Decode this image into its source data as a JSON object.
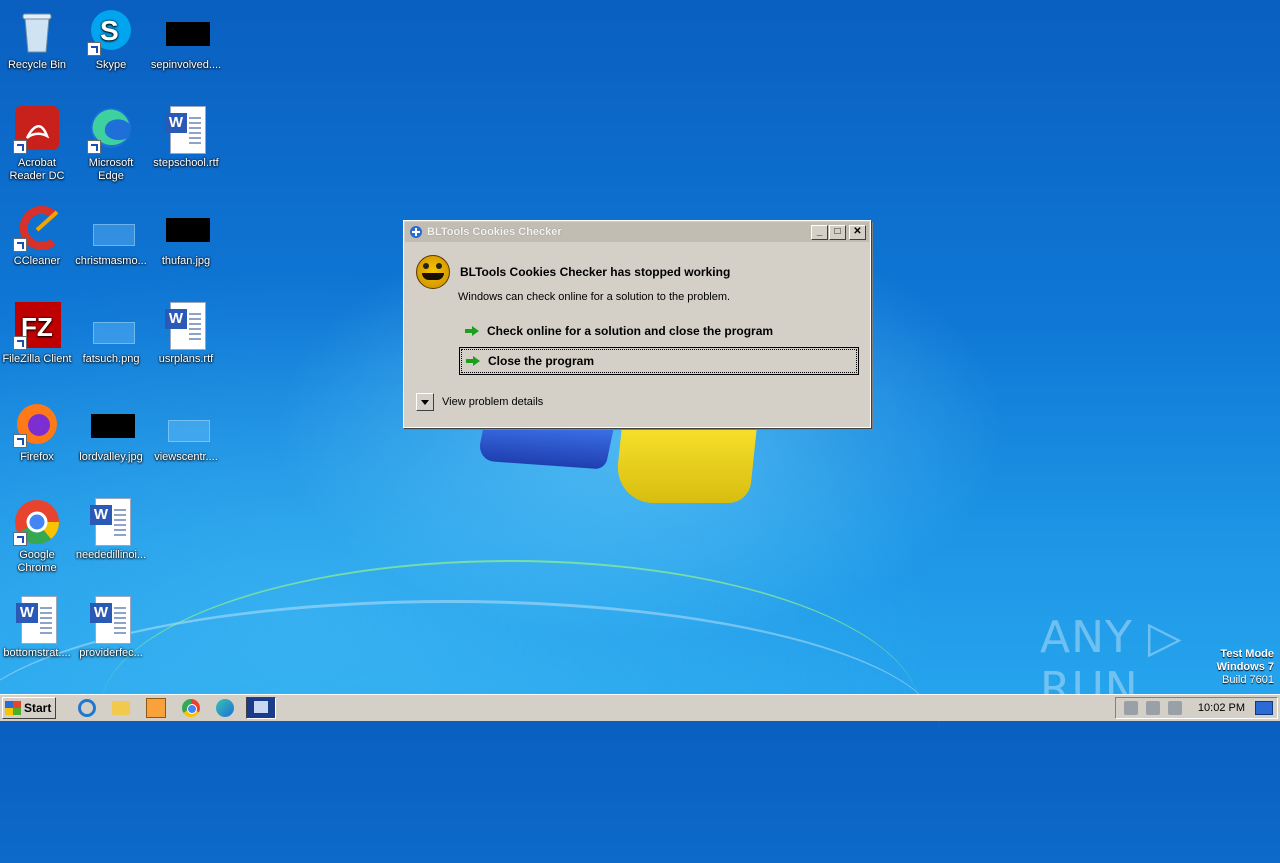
{
  "desktop": {
    "icons": [
      {
        "label": "Recycle Bin"
      },
      {
        "label": "Skype"
      },
      {
        "label": "sepinvolved...."
      },
      {
        "label": "Acrobat Reader DC"
      },
      {
        "label": "Microsoft Edge"
      },
      {
        "label": "stepschool.rtf"
      },
      {
        "label": "CCleaner"
      },
      {
        "label": "christmasmo..."
      },
      {
        "label": "thufan.jpg"
      },
      {
        "label": "FileZilla Client"
      },
      {
        "label": "fatsuch.png"
      },
      {
        "label": "usrplans.rtf"
      },
      {
        "label": "Firefox"
      },
      {
        "label": "lordvalley.jpg"
      },
      {
        "label": "viewscentr...."
      },
      {
        "label": "Google Chrome"
      },
      {
        "label": "neededillinoi..."
      },
      {
        "label": "bottomstrat...."
      },
      {
        "label": "providerfec..."
      }
    ]
  },
  "dialog": {
    "window_title": "BLTools Cookies Checker",
    "heading": "BLTools Cookies Checker has stopped working",
    "message": "Windows can check online for a solution to the problem.",
    "option_check_online": "Check online for a solution and close the program",
    "option_close": "Close the program",
    "details_label": "View problem details",
    "min_glyph": "_",
    "max_glyph": "□",
    "close_glyph": "✕"
  },
  "watermark": {
    "brand": "ANY ▷ RUN",
    "test_mode": "Test Mode",
    "os": "Windows 7",
    "build": "Build 7601"
  },
  "taskbar": {
    "start_label": "Start",
    "clock": "10:02 PM"
  },
  "colors": {
    "dialog_face": "#d4d0c8",
    "desktop_blue": "#0f78d6",
    "arrow_green": "#1aa01a"
  }
}
